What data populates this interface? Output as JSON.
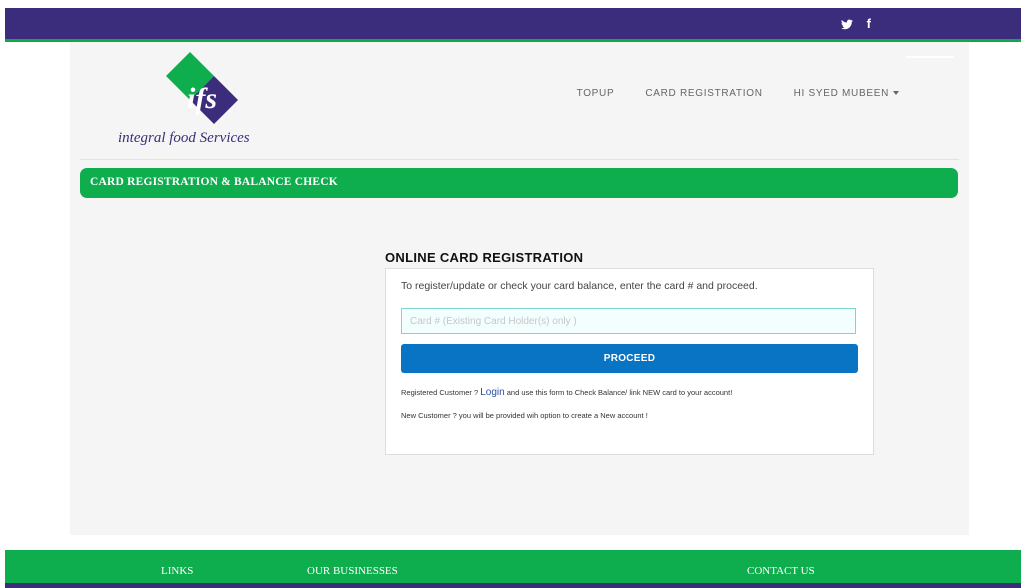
{
  "topbar": {
    "social": [
      {
        "icon": "twitter-icon",
        "glyph": "𝕪"
      },
      {
        "icon": "facebook-icon",
        "glyph": "f"
      }
    ]
  },
  "brand": {
    "logo_letters": "ifs",
    "name": "integral food Services",
    "colors": {
      "purple": "#3c2d7c",
      "green": "#0ead4d"
    }
  },
  "nav": {
    "topup": "TOPUP",
    "card_registration": "CARD REGISTRATION",
    "user_menu": "HI SYED MUBEEN"
  },
  "banner": {
    "title": "CARD REGISTRATION & BALANCE CHECK"
  },
  "registration": {
    "title": "ONLINE CARD REGISTRATION",
    "intro": "To register/update or check your card balance, enter the card # and proceed.",
    "card_placeholder": "Card # (Existing Card Holder(s) only )",
    "card_value": "",
    "proceed_label": "PROCEED",
    "note1_prefix": "Registered Customer ? ",
    "note1_link": "Login",
    "note1_suffix": " and use this form to Check Balance/ link NEW card to your account!",
    "note2": "New Customer ? you will be provided wih option to create a New account !"
  },
  "footer": {
    "links": "LINKS",
    "our_businesses": "OUR BUSINESSES",
    "contact_us": "CONTACT US"
  }
}
